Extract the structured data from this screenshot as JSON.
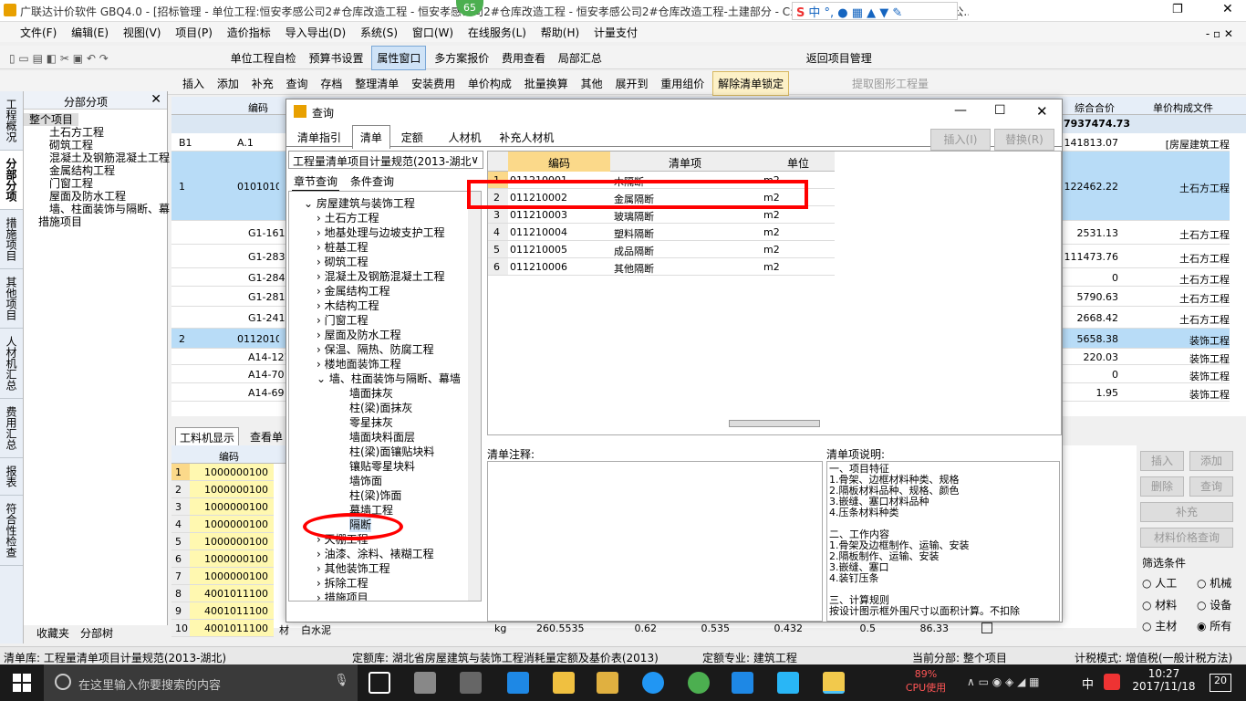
{
  "window": {
    "title": "广联达计价软件 GBQ4.0 - [招标管理 - 单位工程:恒安孝感公司2#仓库改造工程 - 恒安孝感公司2#仓库改造工程 - 恒安孝感公司2#仓库改造工程-土建部分 - C:\\U...7NRHM\\Desktop\\恒安孝感公..."
  },
  "badge": "65",
  "menu": [
    "文件(F)",
    "编辑(E)",
    "视图(V)",
    "项目(P)",
    "造价指标",
    "导入导出(D)",
    "系统(S)",
    "窗口(W)",
    "在线服务(L)",
    "帮助(H)",
    "计量支付"
  ],
  "toolbar1": [
    "单位工程自检",
    "预算书设置",
    "属性窗口",
    "多方案报价",
    "费用查看",
    "局部汇总",
    "返回项目管理"
  ],
  "toolbar2": [
    "插入",
    "添加",
    "补充",
    "查询",
    "存档",
    "整理清单",
    "安装费用",
    "单价构成",
    "批量换算",
    "其他",
    "展开到",
    "重用组价",
    "解除清单锁定",
    "提取图形工程量"
  ],
  "sidetabs": [
    "工程概况",
    "分部分项",
    "措施项目",
    "其他项目",
    "人材机汇总",
    "费用汇总",
    "报表",
    "符合性检查"
  ],
  "left_tree": {
    "header": "分部分项",
    "items": [
      "整个项目",
      "土石方工程",
      "砌筑工程",
      "混凝土及钢筋混凝土工程",
      "金属结构工程",
      "门窗工程",
      "屋面及防水工程",
      "墙、柱面装饰与隔断、幕",
      "措施项目"
    ],
    "bottom_tabs": [
      "收藏夹",
      "分部树"
    ]
  },
  "grid": {
    "headers": {
      "code": "编码",
      "total": "综合合价",
      "file": "单价构成文件"
    },
    "grand_total": "7937474.73",
    "rows": [
      {
        "idx": "B1",
        "code": "A.1",
        "total": "141813.07",
        "file": "[房屋建筑工程"
      },
      {
        "idx": "1",
        "code": "010101003",
        "total": "122462.22",
        "file": "土石方工程"
      },
      {
        "idx": "",
        "code": "G1-161",
        "total": "2531.13",
        "file": "土石方工程"
      },
      {
        "idx": "",
        "code": "G1-283",
        "total": "111473.76",
        "file": "土石方工程"
      },
      {
        "idx": "",
        "code": "G1-284",
        "total": "0",
        "file": "土石方工程"
      },
      {
        "idx": "",
        "code": "G1-281",
        "total": "5790.63",
        "file": "土石方工程"
      },
      {
        "idx": "",
        "code": "G1-241",
        "total": "2668.42",
        "file": "土石方工程"
      },
      {
        "idx": "2",
        "code": "011201001",
        "total": "5658.38",
        "file": "装饰工程"
      },
      {
        "idx": "",
        "code": "A14-121",
        "total": "220.03",
        "file": "装饰工程"
      },
      {
        "idx": "",
        "code": "A14-70",
        "total": "0",
        "file": "装饰工程"
      },
      {
        "idx": "",
        "code": "A14-69",
        "total": "1.95",
        "file": "装饰工程"
      }
    ]
  },
  "dialog": {
    "title": "查询",
    "tabs": [
      "清单指引",
      "清单",
      "定额",
      "人材机",
      "补充人材机"
    ],
    "insert": "插入(I)",
    "replace": "替换(R)",
    "standard": "工程量清单项目计量规范(2013-湖北",
    "subtabs": [
      "章节查询",
      "条件查询"
    ],
    "tree": {
      "root": "房屋建筑与装饰工程",
      "children": [
        "土石方工程",
        "地基处理与边坡支护工程",
        "桩基工程",
        "砌筑工程",
        "混凝土及钢筋混凝土工程",
        "金属结构工程",
        "木结构工程",
        "门窗工程",
        "屋面及防水工程",
        "保温、隔热、防腐工程",
        "楼地面装饰工程",
        "墙、柱面装饰与隔断、幕墙"
      ],
      "sub": [
        "墙面抹灰",
        "柱(梁)面抹灰",
        "零星抹灰",
        "墙面块料面层",
        "柱(梁)面镶贴块料",
        "镶贴零星块料",
        "墙饰面",
        "柱(梁)饰面",
        "幕墙工程",
        "隔断"
      ],
      "after": [
        "天棚工程",
        "油漆、涂料、裱糊工程",
        "其他装饰工程",
        "拆除工程",
        "措施项目"
      ]
    },
    "table": {
      "headers": [
        "编码",
        "清单项",
        "单位"
      ],
      "rows": [
        {
          "n": "1",
          "code": "011210001",
          "name": "木隔断",
          "unit": "m2"
        },
        {
          "n": "2",
          "code": "011210002",
          "name": "金属隔断",
          "unit": "m2"
        },
        {
          "n": "3",
          "code": "011210003",
          "name": "玻璃隔断",
          "unit": "m2"
        },
        {
          "n": "4",
          "code": "011210004",
          "name": "塑料隔断",
          "unit": "m2"
        },
        {
          "n": "5",
          "code": "011210005",
          "name": "成品隔断",
          "unit": "m2"
        },
        {
          "n": "6",
          "code": "011210006",
          "name": "其他隔断",
          "unit": "m2"
        }
      ]
    },
    "note_label": "清单注释:",
    "desc_label": "清单项说明:",
    "desc": [
      "一、项目特征",
      "1.骨架、边框材料种类、规格",
      "2.隔板材料品种、规格、颜色",
      "3.嵌缝、塞口材料品种",
      "4.压条材料种类",
      "",
      "二、工作内容",
      "1.骨架及边框制作、运输、安装",
      "2.隔板制作、运输、安装",
      "3.嵌缝、塞口",
      "4.装钉压条",
      "",
      "三、计算规则",
      "按设计图示框外围尺寸以面积计算。不扣除"
    ]
  },
  "bottom": {
    "tabs": [
      "工料机显示",
      "查看单"
    ],
    "header": "编码",
    "rows": [
      {
        "n": "1",
        "code": "1000000100"
      },
      {
        "n": "2",
        "code": "1000000100"
      },
      {
        "n": "3",
        "code": "1000000100"
      },
      {
        "n": "4",
        "code": "1000000100"
      },
      {
        "n": "5",
        "code": "1000000100"
      },
      {
        "n": "6",
        "code": "1000000100"
      },
      {
        "n": "7",
        "code": "1000000100"
      },
      {
        "n": "8",
        "code": "4001011100"
      },
      {
        "n": "9",
        "code": "4001011100"
      },
      {
        "n": "10",
        "code": "4001011100",
        "type": "材",
        "name": "白水泥",
        "unit": "kg",
        "v1": "260.5535",
        "v2": "0.62",
        "v3": "0.535",
        "v4": "0.432",
        "v5": "0.5",
        "v6": "86.33"
      }
    ]
  },
  "right": {
    "buttons": [
      "插入",
      "添加",
      "删除",
      "查询",
      "补充",
      "材料价格查询"
    ],
    "filter_label": "筛选条件",
    "radios": [
      "人工",
      "机械",
      "材料",
      "设备",
      "主材",
      "所有"
    ]
  },
  "status": {
    "a": "清单库: 工程量清单项目计量规范(2013-湖北)",
    "b": "定额库: 湖北省房屋建筑与装饰工程消耗量定额及基价表(2013)",
    "c": "定额专业: 建筑工程",
    "d": "当前分部: 整个项目",
    "e": "计税模式: 增值税(一般计税方法)"
  },
  "taskbar": {
    "search": "在这里输入你要搜索的内容",
    "cpu": "89%",
    "cpu_label": "CPU使用",
    "ime": "中",
    "time": "10:27",
    "date": "2017/11/18",
    "notif": "20"
  },
  "colors": {
    "highlight": "#ff0000",
    "selrow": "#b8dcf7",
    "yellow": "#fff8b0",
    "accent": "#3c7fc7"
  }
}
